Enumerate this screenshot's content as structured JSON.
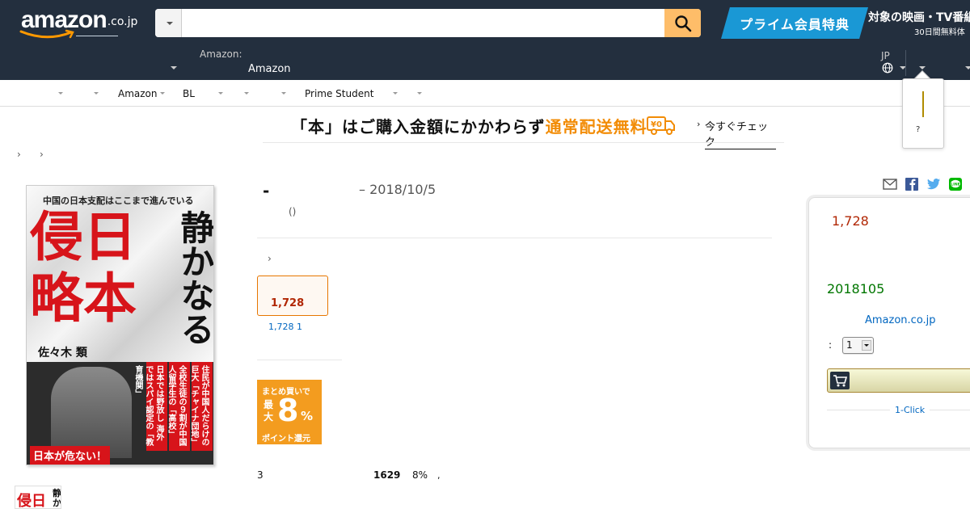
{
  "header": {
    "logo_main": "amazon",
    "logo_tld": ".co.jp",
    "search_placeholder": "",
    "search_icon": "search-icon",
    "prime_banner_title": "プライム会員特典",
    "prime_banner_sub1": "対象の映画・TV番組",
    "prime_banner_sub2": "30日間無料体",
    "deliver_label": "Amazon:",
    "deliver_value": "Amazon",
    "lang_label": "JP",
    "globe_icon": "globe-icon"
  },
  "subnav": {
    "items": [
      "Amazon",
      "BL",
      "Prime Student"
    ]
  },
  "popover": {
    "q": "?"
  },
  "promo": {
    "text_a": "「本」はご購入金額にかかわらず",
    "text_b": "通常配送無料",
    "truck_label": "¥0",
    "link": "今すぐチェック"
  },
  "product": {
    "title_dash": "-",
    "date": "– 2018/10/5",
    "paren": "()",
    "format_price": "1,728",
    "format_sub": "1,728    1"
  },
  "cover": {
    "tagline": "中国の日本支配はここまで進んでいる",
    "big_top": "侵日",
    "big_bottom": "略本",
    "vertical": "静かなる",
    "author": "佐々木 類",
    "band1": "住民が中国人だらけの巨大「チャイナ団地」",
    "band2": "全校生徒の９割が中国人留学生の「高校」",
    "band3": "日本では野放し 海外ではスパイ認定の「教育機関」",
    "red_label": "日本が危ない！",
    "thumb_main": "侵日",
    "thumb_side": "静か"
  },
  "matome": {
    "line1": "まとめ買いで",
    "line2": "最大",
    "num": "8",
    "pct": "%",
    "line3": "ポイント還元"
  },
  "bulk": {
    "count": "3",
    "points": "1629",
    "pct": "8%",
    "comma": ","
  },
  "share": {
    "icons": [
      "mail-icon",
      "facebook-icon",
      "twitter-icon",
      "line-icon"
    ]
  },
  "buybox": {
    "price": "1,728",
    "delivery": "2018105",
    "seller": "Amazon.co.jp",
    "qty_label": ":",
    "qty_value": "1",
    "oneclick": "1-Click"
  }
}
